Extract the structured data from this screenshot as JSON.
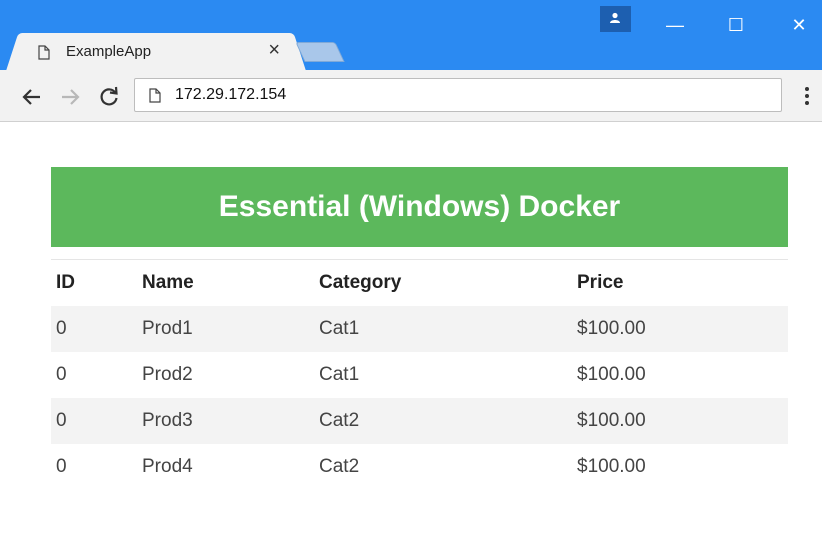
{
  "browser": {
    "tab_title": "ExampleApp",
    "tab_close": "×",
    "url": "172.29.172.154",
    "window_controls": {
      "minimize": "—",
      "maximize": "☐",
      "close": "✕"
    }
  },
  "page": {
    "title": "Essential (Windows) Docker",
    "table": {
      "headers": [
        "ID",
        "Name",
        "Category",
        "Price"
      ],
      "rows": [
        [
          "0",
          "Prod1",
          "Cat1",
          "$100.00"
        ],
        [
          "0",
          "Prod2",
          "Cat1",
          "$100.00"
        ],
        [
          "0",
          "Prod3",
          "Cat2",
          "$100.00"
        ],
        [
          "0",
          "Prod4",
          "Cat2",
          "$100.00"
        ]
      ]
    }
  },
  "colors": {
    "chrome_blue": "#2b8af2",
    "header_green": "#5cb85c"
  },
  "icons": [
    "page-icon",
    "back-arrow-icon",
    "forward-arrow-icon",
    "reload-icon",
    "menu-dots-icon",
    "profile-icon"
  ]
}
